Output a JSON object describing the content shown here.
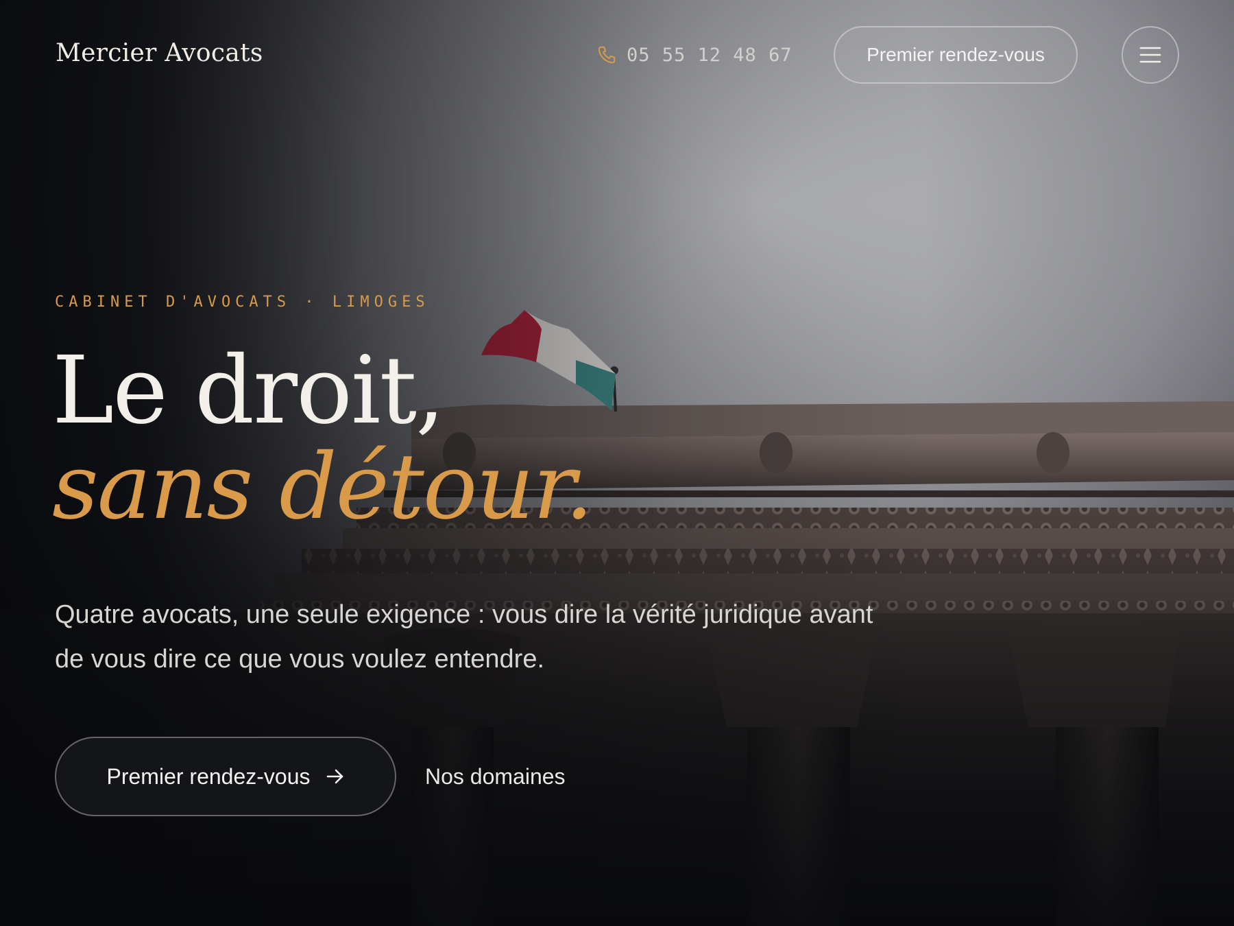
{
  "header": {
    "brand": "Mercier Avocats",
    "phone": {
      "icon": "phone-icon",
      "number": "05 55 12 48 67"
    },
    "cta_label": "Premier rendez-vous",
    "menu_icon": "hamburger-menu-icon"
  },
  "hero": {
    "eyebrow": "CABINET D'AVOCATS · LIMOGES",
    "headline_line1": "Le droit,",
    "headline_line2": "sans détour.",
    "lead": "Quatre avocats, une seule exigence : vous dire la vérité juridique avant de vous dire ce que vous voulez entendre.",
    "primary_cta": {
      "label": "Premier rendez-vous",
      "icon": "arrow-right-icon"
    },
    "secondary_cta": "Nos domaines"
  },
  "colors": {
    "accent": "#d99a4a",
    "background": "#0b0c0f",
    "text": "#f3f0ea",
    "muted": "#d7d6d3"
  }
}
